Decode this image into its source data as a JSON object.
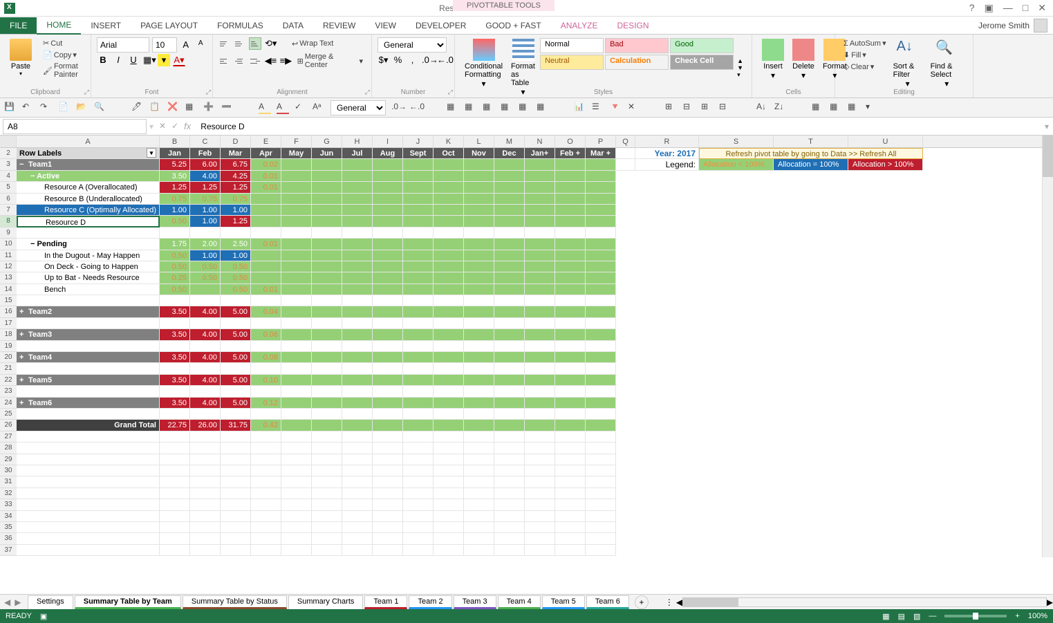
{
  "title": "Resource Planner.xlsx - Excel",
  "pivot_tools": "PIVOTTABLE TOOLS",
  "user": "Jerome Smith",
  "tabs": {
    "file": "FILE",
    "home": "HOME",
    "insert": "INSERT",
    "page": "PAGE LAYOUT",
    "formulas": "FORMULAS",
    "data": "DATA",
    "review": "REVIEW",
    "view": "VIEW",
    "dev": "DEVELOPER",
    "goodfast": "Good + Fast",
    "analyze": "ANALYZE",
    "design": "DESIGN"
  },
  "ribbon": {
    "clipboard": {
      "label": "Clipboard",
      "paste": "Paste",
      "cut": "Cut",
      "copy": "Copy",
      "painter": "Format Painter"
    },
    "font": {
      "label": "Font",
      "name": "Arial",
      "size": "10"
    },
    "alignment": {
      "label": "Alignment",
      "wrap": "Wrap Text",
      "merge": "Merge & Center"
    },
    "number": {
      "label": "Number",
      "format": "General"
    },
    "styles": {
      "label": "Styles",
      "conditional": "Conditional Formatting",
      "table": "Format as Table",
      "normal": "Normal",
      "bad": "Bad",
      "good": "Good",
      "neutral": "Neutral",
      "calc": "Calculation",
      "check": "Check Cell"
    },
    "cells": {
      "label": "Cells",
      "insert": "Insert",
      "delete": "Delete",
      "format": "Format"
    },
    "editing": {
      "label": "Editing",
      "autosum": "AutoSum",
      "fill": "Fill",
      "clear": "Clear",
      "sort": "Sort & Filter",
      "find": "Find & Select"
    }
  },
  "qat_number": "General",
  "name_box": "A8",
  "formula_value": "Resource D",
  "columns": [
    "A",
    "B",
    "C",
    "D",
    "E",
    "F",
    "G",
    "H",
    "I",
    "J",
    "K",
    "L",
    "M",
    "N",
    "O",
    "P",
    "Q",
    "R",
    "S",
    "T",
    "U"
  ],
  "months": [
    "Jan",
    "Feb",
    "Mar",
    "Apr",
    "May",
    "Jun",
    "Jul",
    "Aug",
    "Sept",
    "Oct",
    "Nov",
    "Dec",
    "Jan+",
    "Feb +",
    "Mar +"
  ],
  "row_labels_header": "Row Labels",
  "year": "Year: 2017",
  "refresh": "Refresh pivot table by going to Data >> Refresh All",
  "legend": {
    "label": "Legend:",
    "lt": "Allocation < 100%",
    "eq": "Allocation = 100%",
    "gt": "Allocation > 100%"
  },
  "rows": [
    {
      "r": 3,
      "label": "Team1",
      "type": "team",
      "collapse": "−",
      "v": [
        "5.25",
        "6.00",
        "6.75",
        "0.02"
      ],
      "cls": [
        "bg-red",
        "bg-red",
        "bg-red",
        "bg-green"
      ]
    },
    {
      "r": 4,
      "label": "Active",
      "type": "active",
      "collapse": "−",
      "v": [
        "3.50",
        "4.00",
        "4.25",
        "0.01"
      ],
      "cls": [
        "bg-green-white",
        "bg-blue",
        "bg-red",
        "bg-green"
      ]
    },
    {
      "r": 5,
      "label": "Resource A (Overallocated)",
      "type": "item",
      "v": [
        "1.25",
        "1.25",
        "1.25",
        "0.01"
      ],
      "cls": [
        "bg-red",
        "bg-red",
        "bg-red",
        "bg-green"
      ]
    },
    {
      "r": 6,
      "label": "Resource B (Underallocated)",
      "type": "item",
      "v": [
        "0.75",
        "0.75",
        "0.75",
        ""
      ],
      "cls": [
        "bg-green",
        "bg-green",
        "bg-green",
        "bg-green-empty"
      ]
    },
    {
      "r": 7,
      "label": "Resource C (Optimally Allocated)",
      "type": "item",
      "v": [
        "1.00",
        "1.00",
        "1.00",
        ""
      ],
      "cls": [
        "bg-blue",
        "bg-blue",
        "bg-blue",
        "bg-green-empty"
      ],
      "rowbg": "bg-blue"
    },
    {
      "r": 8,
      "label": "Resource D",
      "type": "item",
      "v": [
        "0.50",
        "1.00",
        "1.25",
        ""
      ],
      "cls": [
        "bg-green",
        "bg-blue",
        "bg-red",
        "bg-green-empty"
      ],
      "selected": true
    },
    {
      "r": 9,
      "label": "",
      "type": "blank"
    },
    {
      "r": 10,
      "label": "Pending",
      "type": "pending",
      "collapse": "−",
      "v": [
        "1.75",
        "2.00",
        "2.50",
        "0.01"
      ],
      "cls": [
        "bg-green-white",
        "bg-green-white",
        "bg-green-white",
        "bg-green"
      ]
    },
    {
      "r": 11,
      "label": "In the Dugout - May Happen",
      "type": "item",
      "v": [
        "0.50",
        "1.00",
        "1.00",
        ""
      ],
      "cls": [
        "bg-green",
        "bg-blue",
        "bg-blue",
        "bg-green-empty"
      ]
    },
    {
      "r": 12,
      "label": "On Deck - Going to Happen",
      "type": "item",
      "v": [
        "0.50",
        "0.50",
        "0.50",
        ""
      ],
      "cls": [
        "bg-green",
        "bg-green",
        "bg-green",
        "bg-green-empty"
      ]
    },
    {
      "r": 13,
      "label": "Up to Bat - Needs Resource",
      "type": "item",
      "v": [
        "0.25",
        "0.50",
        "0.50",
        ""
      ],
      "cls": [
        "bg-green",
        "bg-green",
        "bg-green",
        "bg-green-empty"
      ]
    },
    {
      "r": 14,
      "label": "Bench",
      "type": "item",
      "v": [
        "0.50",
        "",
        "0.50",
        "0.01"
      ],
      "cls": [
        "bg-green",
        "bg-green-empty",
        "bg-green",
        "bg-green"
      ]
    },
    {
      "r": 15,
      "label": "",
      "type": "blank"
    },
    {
      "r": 16,
      "label": "Team2",
      "type": "team",
      "collapse": "+",
      "v": [
        "3.50",
        "4.00",
        "5.00",
        "0.04"
      ],
      "cls": [
        "bg-red",
        "bg-red",
        "bg-red",
        "bg-green"
      ]
    },
    {
      "r": 17,
      "label": "",
      "type": "blank"
    },
    {
      "r": 18,
      "label": "Team3",
      "type": "team",
      "collapse": "+",
      "v": [
        "3.50",
        "4.00",
        "5.00",
        "0.06"
      ],
      "cls": [
        "bg-red",
        "bg-red",
        "bg-red",
        "bg-green"
      ]
    },
    {
      "r": 19,
      "label": "",
      "type": "blank"
    },
    {
      "r": 20,
      "label": "Team4",
      "type": "team",
      "collapse": "+",
      "v": [
        "3.50",
        "4.00",
        "5.00",
        "0.08"
      ],
      "cls": [
        "bg-red",
        "bg-red",
        "bg-red",
        "bg-green"
      ]
    },
    {
      "r": 21,
      "label": "",
      "type": "blank"
    },
    {
      "r": 22,
      "label": "Team5",
      "type": "team",
      "collapse": "+",
      "v": [
        "3.50",
        "4.00",
        "5.00",
        "0.10"
      ],
      "cls": [
        "bg-red",
        "bg-red",
        "bg-red",
        "bg-green"
      ]
    },
    {
      "r": 23,
      "label": "",
      "type": "blank"
    },
    {
      "r": 24,
      "label": "Team6",
      "type": "team",
      "collapse": "+",
      "v": [
        "3.50",
        "4.00",
        "5.00",
        "0.12"
      ],
      "cls": [
        "bg-red",
        "bg-red",
        "bg-red",
        "bg-green"
      ]
    },
    {
      "r": 25,
      "label": "",
      "type": "blank"
    },
    {
      "r": 26,
      "label": "Grand Total",
      "type": "total",
      "v": [
        "22.75",
        "26.00",
        "31.75",
        "0.42"
      ],
      "cls": [
        "bg-red",
        "bg-red",
        "bg-red",
        "bg-green"
      ]
    }
  ],
  "sheets": [
    "Settings",
    "Summary Table by Team",
    "Summary Table by Status",
    "Summary Charts",
    "Team 1",
    "Team 2",
    "Team 3",
    "Team 4",
    "Team 5",
    "Team 6"
  ],
  "sheet_colors": [
    "",
    "c-green",
    "c-brown",
    "",
    "c-red",
    "c-blue",
    "c-purple",
    "c-green",
    "c-blue",
    "c-teal"
  ],
  "active_sheet": 1,
  "status": "READY",
  "zoom": "100%"
}
